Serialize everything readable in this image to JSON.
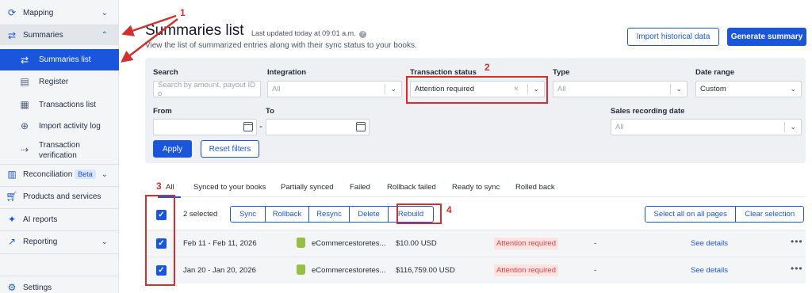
{
  "sidebar": {
    "items": [
      {
        "label": "Mapping",
        "icon": "sync-icon",
        "chevron": "⌄"
      },
      {
        "label": "Summaries",
        "icon": "arrows-icon",
        "chevron": "⌃"
      },
      {
        "label": "Summaries list",
        "icon": "arrows-icon"
      },
      {
        "label": "Register",
        "icon": "document-icon"
      },
      {
        "label": "Transactions list",
        "icon": "table-icon"
      },
      {
        "label": "Import activity log",
        "icon": "import-icon"
      },
      {
        "label": "Transaction",
        "label2": "verification",
        "icon": "verify-icon"
      },
      {
        "label": "Reconciliation",
        "badge": "Beta",
        "icon": "reconcile-icon",
        "chevron": "⌄"
      },
      {
        "label": "Products and services",
        "icon": "cart-icon"
      },
      {
        "label": "AI reports",
        "icon": "sparkle-icon"
      },
      {
        "label": "Reporting",
        "icon": "chart-icon",
        "chevron": "⌄"
      },
      {
        "label": "Settings",
        "icon": "gear-icon"
      }
    ]
  },
  "header": {
    "title": "Summaries list",
    "updated": "Last updated today at 09:01 a.m.",
    "subtitle": "View the list of summarized entries along with their sync status to your books.",
    "import_btn": "Import historical data",
    "generate_btn": "Generate summary"
  },
  "filters": {
    "search": {
      "label": "Search",
      "placeholder": "Search by amount, payout ID o"
    },
    "integration": {
      "label": "Integration",
      "value": "All"
    },
    "transaction_status": {
      "label": "Transaction status",
      "value": "Attention required"
    },
    "type": {
      "label": "Type",
      "value": "All"
    },
    "date_range": {
      "label": "Date range",
      "value": "Custom"
    },
    "from": {
      "label": "From"
    },
    "to": {
      "label": "To"
    },
    "sales_recording_date": {
      "label": "Sales recording date",
      "value": "All"
    },
    "apply": "Apply",
    "reset": "Reset filters"
  },
  "tabs": [
    "All",
    "Synced to your books",
    "Partially synced",
    "Failed",
    "Rollback failed",
    "Ready to sync",
    "Rolled back"
  ],
  "toolbar": {
    "selected": "2 selected",
    "actions": [
      "Sync",
      "Rollback",
      "Resync",
      "Delete",
      "Rebuild"
    ],
    "select_all": "Select all on all pages",
    "clear": "Clear selection"
  },
  "rows": [
    {
      "date": "Feb 11 - Feb 11, 2026",
      "store": "eCommercestoretes...",
      "amount": "$10.00 USD",
      "status": "Attention required",
      "dash": "-",
      "action": "See details",
      "more": "•••"
    },
    {
      "date": "Jan 20 - Jan 20, 2026",
      "store": "eCommercestoretes...",
      "amount": "$116,759.00 USD",
      "status": "Attention required",
      "dash": "-",
      "action": "See details",
      "more": "•••"
    }
  ],
  "annotations": [
    "1",
    "2",
    "3",
    "4"
  ],
  "colors": {
    "accent": "#1a56db",
    "annotation": "#d32f2f",
    "status_bg": "#fde2e1",
    "status_text": "#d64545"
  }
}
